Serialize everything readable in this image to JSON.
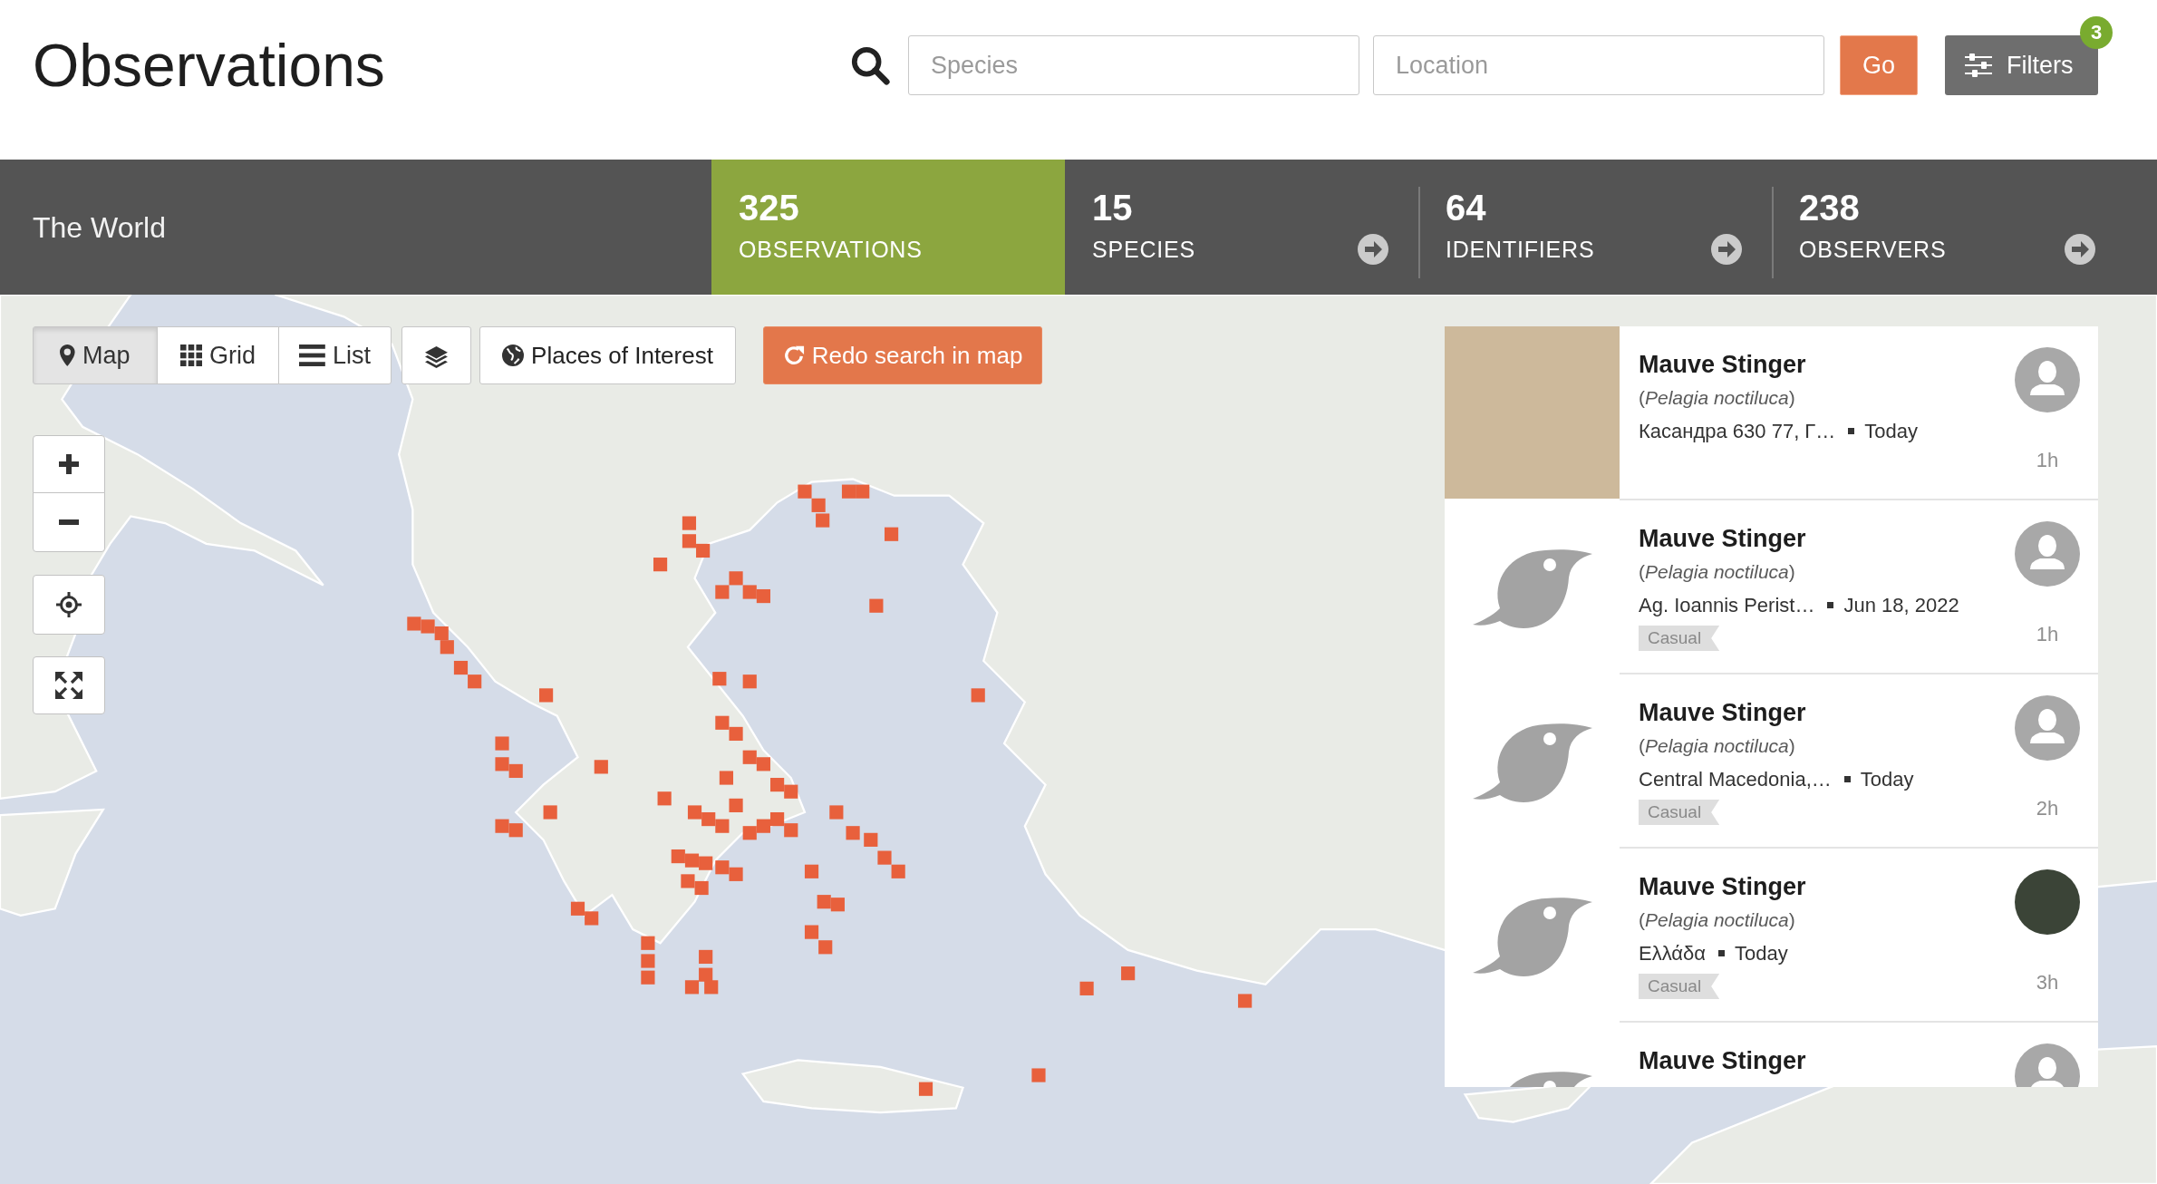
{
  "header": {
    "title": "Observations",
    "species_placeholder": "Species",
    "location_placeholder": "Location",
    "go_label": "Go",
    "filters_label": "Filters",
    "filters_count": "3"
  },
  "place_bar": {
    "place": "The World",
    "stats": [
      {
        "count": "325",
        "label": "OBSERVATIONS",
        "selected": true
      },
      {
        "count": "15",
        "label": "SPECIES",
        "selected": false
      },
      {
        "count": "64",
        "label": "IDENTIFIERS",
        "selected": false
      },
      {
        "count": "238",
        "label": "OBSERVERS",
        "selected": false
      }
    ]
  },
  "map": {
    "view_tabs": [
      {
        "label": "Map",
        "selected": true
      },
      {
        "label": "Grid",
        "selected": false
      },
      {
        "label": "List",
        "selected": false
      }
    ],
    "places_label": "Places of Interest",
    "redo_label": "Redo search in map"
  },
  "observations": [
    {
      "kind": "photo",
      "common_name": "Mauve Stinger",
      "scientific_name": "(*Pelagia noctiluca*)",
      "place": "Касандра 630 77, Г…",
      "date": "Today",
      "time_ago": "1h",
      "avatar": {
        "kind": "default"
      }
    },
    {
      "kind": "icon",
      "common_name": "Mauve Stinger",
      "scientific_name": "(*Pelagia noctiluca*)",
      "place": "Ag. Ioannis Perist…",
      "date": "Jun 18, 2022",
      "quality_grade": "Casual",
      "time_ago": "1h",
      "avatar": {
        "kind": "default"
      }
    },
    {
      "kind": "icon",
      "common_name": "Mauve Stinger",
      "scientific_name": "(*Pelagia noctiluca*)",
      "place": "Central Macedonia,…",
      "date": "Today",
      "quality_grade": "Casual",
      "time_ago": "2h",
      "avatar": {
        "kind": "default"
      }
    },
    {
      "kind": "icon",
      "common_name": "Mauve Stinger",
      "scientific_name": "(*Pelagia noctiluca*)",
      "place": "Ελλάδα",
      "date": "Today",
      "quality_grade": "Casual",
      "time_ago": "3h",
      "avatar": {
        "kind": "photo"
      }
    },
    {
      "kind": "icon",
      "common_name": "Mauve Stinger",
      "avatar": {
        "kind": "default"
      }
    }
  ]
}
